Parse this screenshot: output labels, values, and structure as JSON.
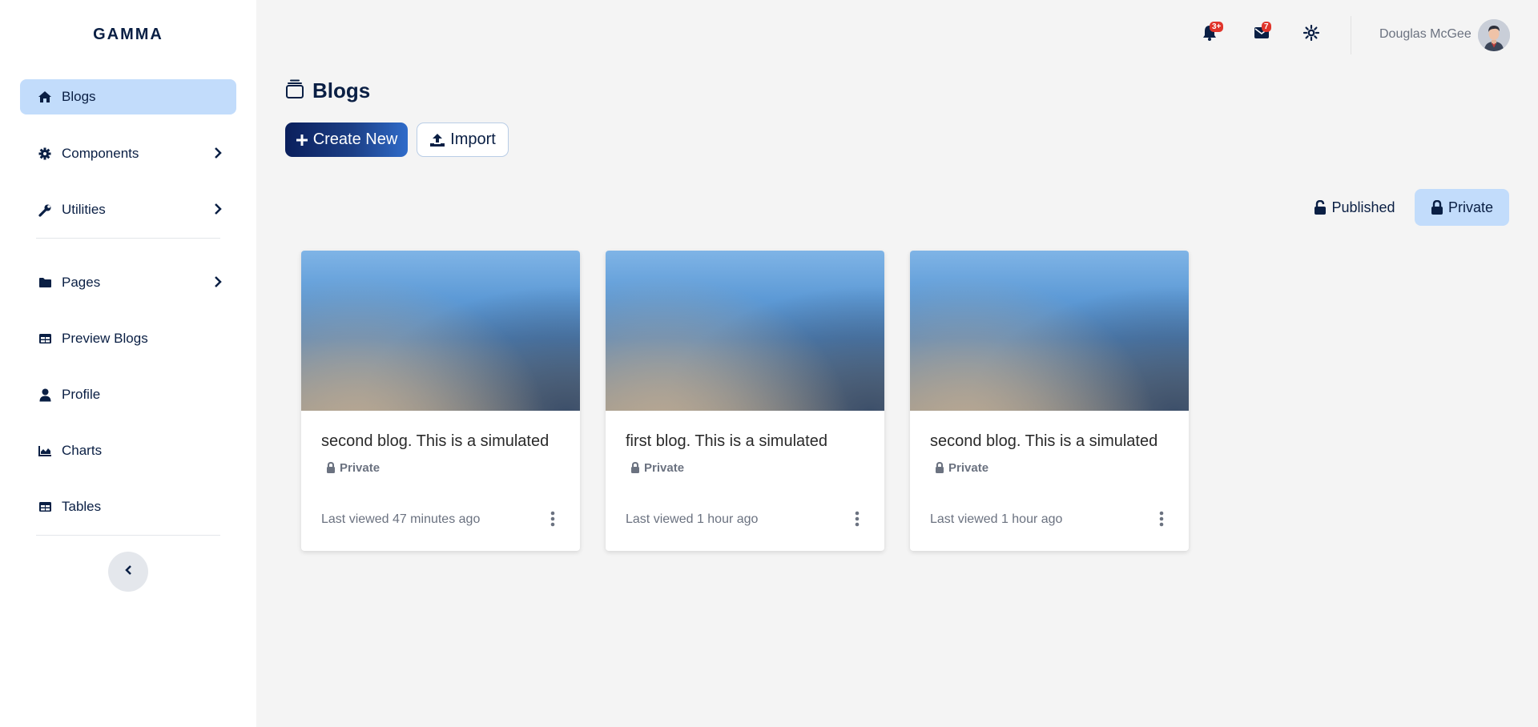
{
  "app": {
    "brand": "GAMMA"
  },
  "sidebar": {
    "items": [
      {
        "label": "Blogs",
        "icon": "home-icon",
        "active": true
      },
      {
        "label": "Components",
        "icon": "gear-icon",
        "has_children": true
      },
      {
        "label": "Utilities",
        "icon": "wrench-icon",
        "has_children": true
      },
      {
        "label": "Pages",
        "icon": "folder-icon",
        "has_children": true
      },
      {
        "label": "Preview Blogs",
        "icon": "table-icon"
      },
      {
        "label": "Profile",
        "icon": "user-icon"
      },
      {
        "label": "Charts",
        "icon": "area-chart-icon"
      },
      {
        "label": "Tables",
        "icon": "table-icon"
      }
    ],
    "collapse_icon": "chevron-left-icon"
  },
  "header": {
    "notifications": {
      "icon": "bell-icon",
      "badge": "3+"
    },
    "messages": {
      "icon": "envelope-icon",
      "badge": "7"
    },
    "theme": {
      "icon": "sun-icon"
    },
    "user": {
      "name": "Douglas McGee",
      "avatar": "avatar-image"
    }
  },
  "main": {
    "title": "Blogs",
    "title_icon": "layers-icon",
    "actions": {
      "create_label": "Create New",
      "import_label": "Import"
    },
    "filters": {
      "published_label": "Published",
      "private_label": "Private",
      "active": "private"
    },
    "cards": [
      {
        "title": "second blog. This is a simulated",
        "status": "Private",
        "meta": "Last viewed 47 minutes ago"
      },
      {
        "title": "first blog. This is a simulated",
        "status": "Private",
        "meta": "Last viewed 1 hour ago"
      },
      {
        "title": "second blog. This is a simulated",
        "status": "Private",
        "meta": "Last viewed 1 hour ago"
      }
    ]
  },
  "colors": {
    "primary": "#0a1f44",
    "active_bg": "#c2dcfb",
    "badge": "#e0352b",
    "page_bg": "#f4f4f4"
  }
}
